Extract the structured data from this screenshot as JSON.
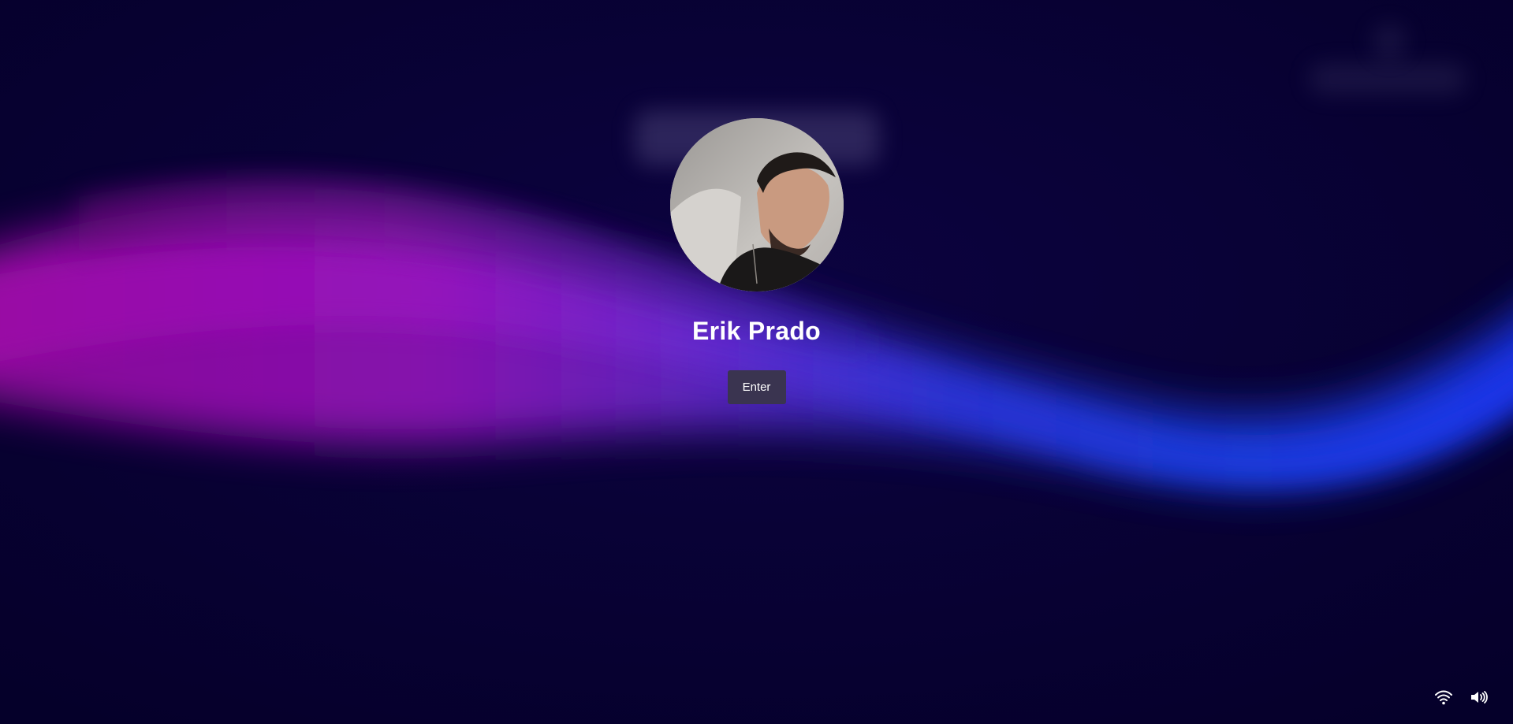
{
  "lock_screen": {
    "user_name": "Erik Prado",
    "enter_label": "Enter",
    "avatar_icon": "user-photo"
  },
  "tray": {
    "wifi_icon": "wifi-icon",
    "volume_icon": "volume-icon"
  },
  "colors": {
    "background": "#07002f",
    "wave_magenta": "#9b10b8",
    "wave_blue": "#1d4bff",
    "button": "#3a3450",
    "text": "#ffffff"
  }
}
